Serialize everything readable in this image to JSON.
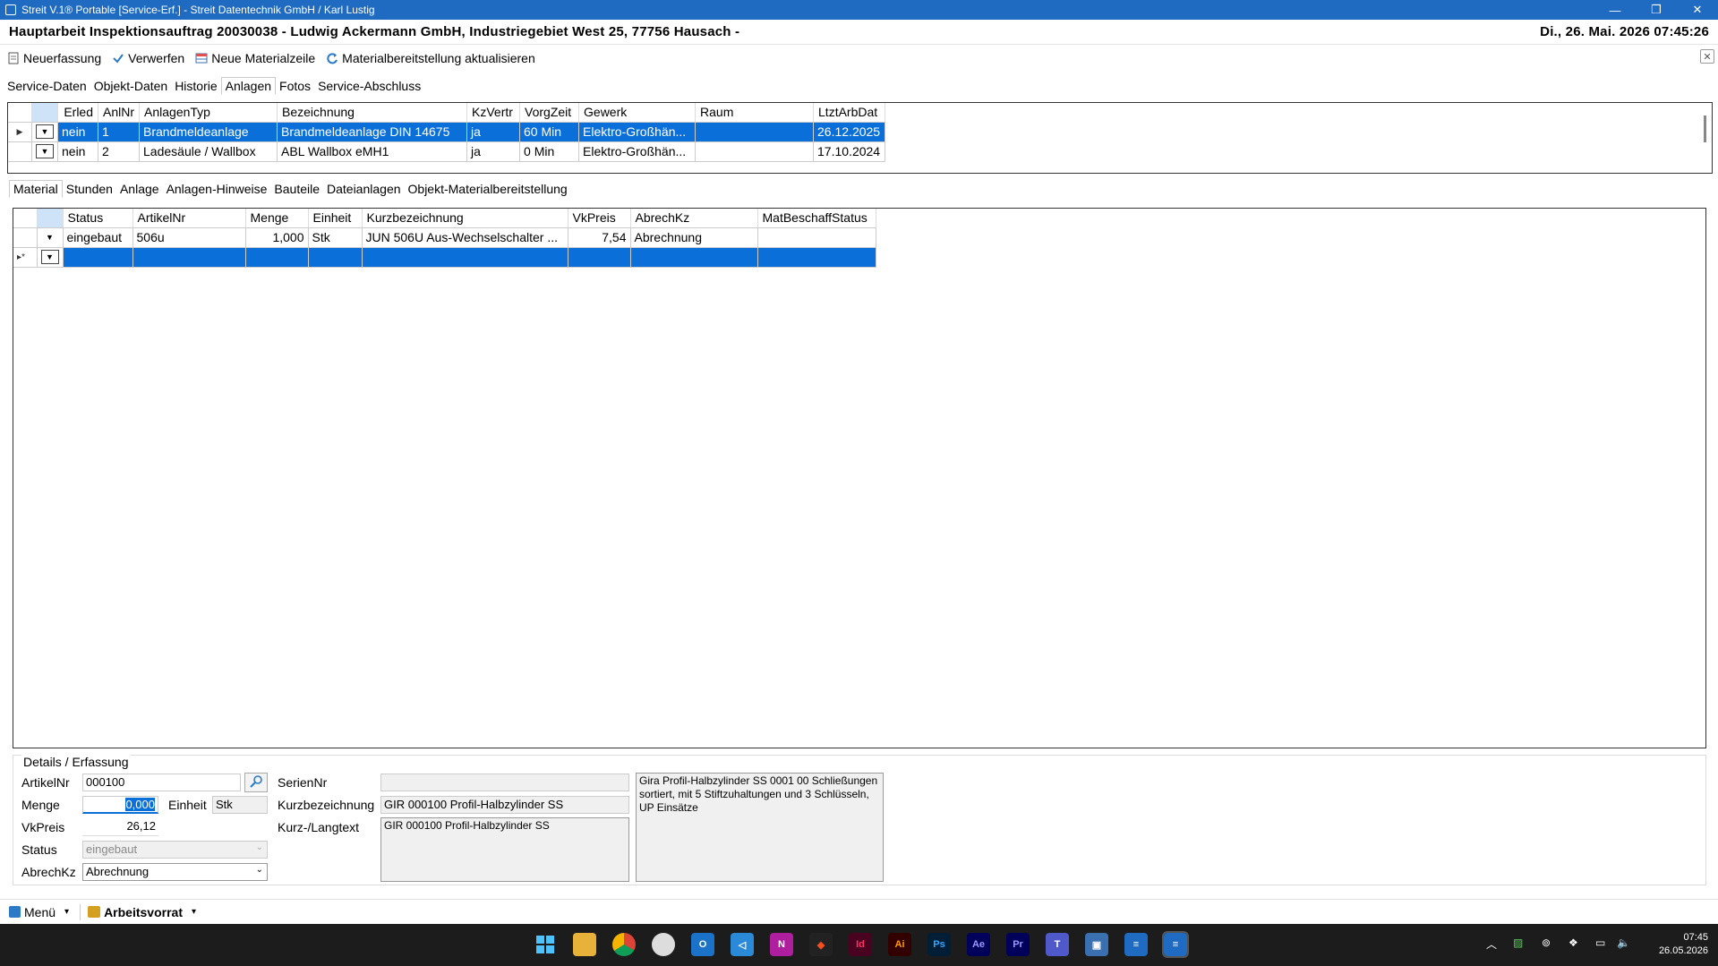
{
  "window": {
    "title": "Streit V.1® Portable [Service-Erf.] - Streit Datentechnik GmbH / Karl Lustig",
    "minimize": "—",
    "restore": "❐",
    "close": "✕"
  },
  "header": {
    "title": "Hauptarbeit Inspektionsauftrag 20030038  -  Ludwig Ackermann GmbH, Industriegebiet West 25, 77756 Hausach  -",
    "datetime": "Di., 26. Mai. 2026 07:45:26"
  },
  "toolbar": {
    "neuerfassung": "Neuerfassung",
    "verwerfen": "Verwerfen",
    "neue_materialzeile": "Neue Materialzeile",
    "aktualisieren": "Materialbereitstellung aktualisieren"
  },
  "main_tabs": [
    "Service-Daten",
    "Objekt-Daten",
    "Historie",
    "Anlagen",
    "Fotos",
    "Service-Abschluss"
  ],
  "anlagen_grid": {
    "columns": [
      "Erled",
      "AnlNr",
      "AnlagenTyp",
      "Bezeichnung",
      "KzVertr",
      "VorgZeit",
      "Gewerk",
      "Raum",
      "LtztArbDat"
    ],
    "rows": [
      [
        "nein",
        "1",
        "Brandmeldeanlage",
        "Brandmeldeanlage DIN 14675",
        "ja",
        "60 Min",
        "Elektro-Großhän...",
        "",
        "26.12.2025"
      ],
      [
        "nein",
        "2",
        "Ladesäule / Wallbox",
        "ABL Wallbox eMH1",
        "ja",
        "0 Min",
        "Elektro-Großhän...",
        "",
        "17.10.2024"
      ]
    ]
  },
  "sub_tabs": [
    "Material",
    "Stunden",
    "Anlage",
    "Anlagen-Hinweise",
    "Bauteile",
    "Dateianlagen",
    "Objekt-Materialbereitstellung"
  ],
  "material_grid": {
    "columns": [
      "Status",
      "ArtikelNr",
      "Menge",
      "Einheit",
      "Kurzbezeichnung",
      "VkPreis",
      "AbrechKz",
      "MatBeschaffStatus"
    ],
    "rows": [
      [
        "eingebaut",
        "506u",
        "1,000",
        "Stk",
        "JUN 506U Aus-Wechselschalter ...",
        "7,54",
        "Abrechnung",
        ""
      ]
    ],
    "new_row_marker": "▸*"
  },
  "details": {
    "title": "Details / Erfassung",
    "artikelnr_label": "ArtikelNr",
    "artikelnr": "000100",
    "menge_label": "Menge",
    "menge": "0,000",
    "einheit_label": "Einheit",
    "einheit": "Stk",
    "vkpreis_label": "VkPreis",
    "vkpreis": "26,12",
    "status_label": "Status",
    "status": "eingebaut",
    "abrechkz_label": "AbrechKz",
    "abrechkz": "Abrechnung",
    "seriennr_label": "SerienNr",
    "seriennr": "",
    "kurzbez_label": "Kurzbezeichnung",
    "kurzbez": "GIR 000100 Profil-Halbzylinder SS",
    "langtext_label": "Kurz-/Langtext",
    "langtext": "GIR 000100 Profil-Halbzylinder SS",
    "beschreibung": "Gira Profil-Halbzylinder SS 0001 00 Schließungen sortiert, mit 5 Stiftzuhaltungen und 3 Schlüsseln, UP Einsätze"
  },
  "statusbar": {
    "menu": "Menü",
    "arbeitsvorrat": "Arbeitsvorrat"
  },
  "taskbar": {
    "time": "07:45",
    "date": "26.05.2026"
  },
  "colors": {
    "titlebar": "#1f6bc1",
    "selection": "#0a6fd8",
    "taskbar": "#1c1c1c"
  }
}
